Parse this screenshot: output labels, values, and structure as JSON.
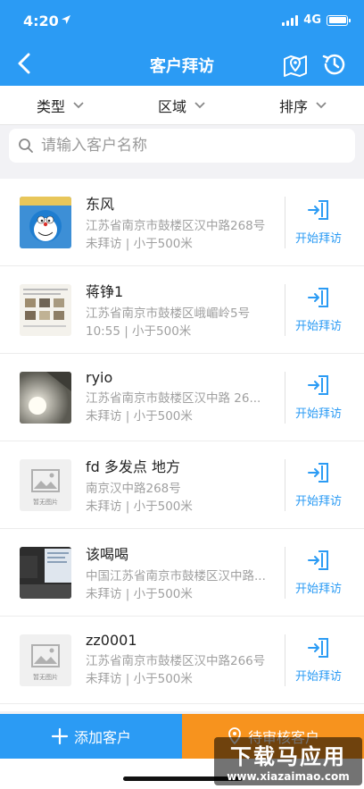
{
  "status": {
    "time": "4:20",
    "network": "4G"
  },
  "nav": {
    "title": "客户拜访",
    "icons": [
      "back-icon",
      "map-icon",
      "history-icon"
    ]
  },
  "filters": [
    {
      "label": "类型"
    },
    {
      "label": "区域"
    },
    {
      "label": "排序"
    }
  ],
  "search": {
    "placeholder": "请输入客户名称",
    "value": ""
  },
  "customers": [
    {
      "name": "东风",
      "address": "江苏省南京市鼓楼区汉中路268号",
      "status": "未拜访 | 小于500米",
      "thumb": "doraemon-photo",
      "action": "开始拜访"
    },
    {
      "name": "蒋铮1",
      "address": "江苏省南京市鼓楼区峨嵋岭5号",
      "status": "10:55 | 小于500米",
      "thumb": "document-photo",
      "action": "开始拜访"
    },
    {
      "name": "ryio",
      "address": "江苏省南京市鼓楼区汉中路 26...",
      "status": "未拜访 | 小于500米",
      "thumb": "lamp-photo",
      "action": "开始拜访"
    },
    {
      "name": "fd 多发点 地方",
      "address": "南京汉中路268号",
      "status": "未拜访 | 小于500米",
      "thumb": "no-image",
      "thumb_label": "暂无图片",
      "action": "开始拜访"
    },
    {
      "name": "该喝喝",
      "address": "中国江苏省南京市鼓楼区汉中路...",
      "status": "未拜访 | 小于500米",
      "thumb": "monitor-photo",
      "action": "开始拜访"
    },
    {
      "name": "zz0001",
      "address": "江苏省南京市鼓楼区汉中路266号",
      "status": "未拜访 | 小于500米",
      "thumb": "no-image",
      "thumb_label": "暂无图片",
      "action": "开始拜访"
    }
  ],
  "bottom": {
    "add_label": "添加客户",
    "pending_label": "待审核客户"
  },
  "watermark": {
    "title": "下载马应用",
    "url": "www.xiazaimao.com"
  },
  "colors": {
    "primary": "#2b9bf4",
    "accent": "#f7931e"
  }
}
